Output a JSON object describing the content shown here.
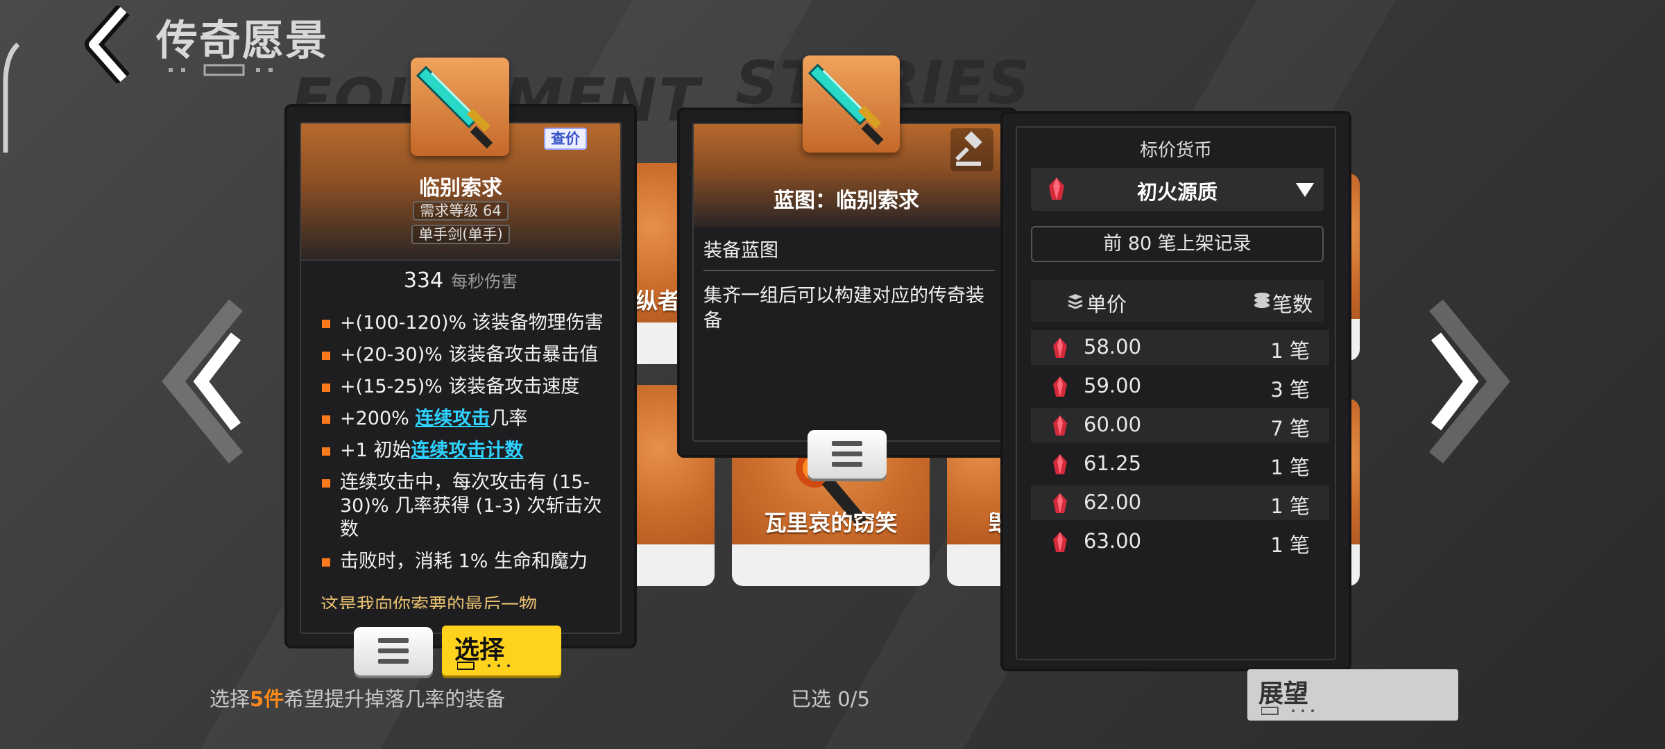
{
  "header": {
    "title": "传奇愿景"
  },
  "background": {
    "word_left": "EQUIPMENT",
    "word_mid": "STORIES"
  },
  "bg_cards": [
    {
      "label": "纵者"
    },
    {
      "label": "瓦里哀的窃笑"
    },
    {
      "label": "毁"
    }
  ],
  "item_tooltip": {
    "name": "临别索求",
    "query_price_label": "查价",
    "required_level": "需求等级 64",
    "weapon_type": "单手剑(单手)",
    "dps_value": "334",
    "dps_label": "每秒伤害",
    "stats": [
      {
        "parts": [
          "+(100-120)% 该装备物理伤害"
        ]
      },
      {
        "parts": [
          "+(20-30)% 该装备攻击暴击值"
        ]
      },
      {
        "parts": [
          "+(15-25)% 该装备攻击速度"
        ]
      },
      {
        "parts": [
          "+200% ",
          "连续攻击",
          "几率"
        ]
      },
      {
        "parts": [
          "+1 初始",
          "连续攻击计数",
          ""
        ]
      },
      {
        "parts": [
          "连续攻击中，每次攻击有 (15-30)% 几率获得 (1-3) 次斩击次数"
        ]
      },
      {
        "parts": [
          "击败时，消耗 1% 生命和魔力"
        ]
      }
    ],
    "flavor_text": "这是我向你索要的最后一物",
    "select_label": "选择"
  },
  "blueprint_tooltip": {
    "title": "蓝图：临别索求",
    "category": "装备蓝图",
    "description": "集齐一组后可以构建对应的传奇装备"
  },
  "price_panel": {
    "currency_label": "标价货币",
    "currency_name": "初火源质",
    "records_label": "前 80 笔上架记录",
    "col_price": "单价",
    "col_count": "笔数",
    "rows": [
      {
        "price": "58.00",
        "count": "1 笔"
      },
      {
        "price": "59.00",
        "count": "3 笔"
      },
      {
        "price": "60.00",
        "count": "7 笔"
      },
      {
        "price": "61.25",
        "count": "1 笔"
      },
      {
        "price": "62.00",
        "count": "1 笔"
      },
      {
        "price": "63.00",
        "count": "1 笔"
      }
    ]
  },
  "footer": {
    "hint_prefix": "选择",
    "hint_highlight": "5件",
    "hint_suffix": "希望提升掉落几率的装备",
    "selected_count": "已选 0/5",
    "outlook_label": "展望"
  },
  "colors": {
    "accent_orange": "#ff7a1a",
    "keyword_cyan": "#2fd3ff",
    "select_yellow": "#ffd21e"
  }
}
